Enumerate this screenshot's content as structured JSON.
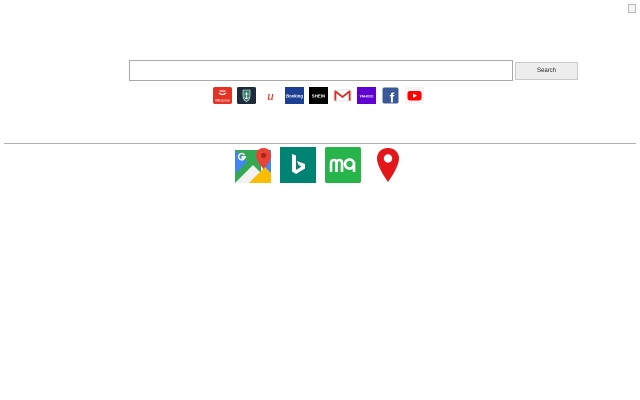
{
  "search": {
    "value": "",
    "placeholder": "",
    "button_label": "Search"
  },
  "shortcuts": [
    {
      "name": "aliexpress",
      "label": "AliExpress",
      "icon": "aliexpress-icon",
      "color": "#e43225"
    },
    {
      "name": "anchor",
      "label": "",
      "icon": "anchor-shield-icon",
      "color": "#1d2b3a"
    },
    {
      "name": "unknown-u",
      "label": "u",
      "icon": "u-logo-icon",
      "color": "#e2231a"
    },
    {
      "name": "booking",
      "label": "Booking",
      "icon": "booking-icon",
      "color": "#1c3f94"
    },
    {
      "name": "shein",
      "label": "SHEIN",
      "icon": "shein-icon",
      "color": "#000000"
    },
    {
      "name": "gmail",
      "label": "",
      "icon": "gmail-icon",
      "color": "#d93025"
    },
    {
      "name": "yahoo",
      "label": "YAHOO!",
      "icon": "yahoo-icon",
      "color": "#5f01d1"
    },
    {
      "name": "facebook",
      "label": "f",
      "icon": "facebook-icon",
      "color": "#3b5998"
    },
    {
      "name": "youtube",
      "label": "",
      "icon": "youtube-icon",
      "color": "#ff0000"
    }
  ],
  "apps": [
    {
      "name": "google-maps",
      "icon": "google-maps-icon"
    },
    {
      "name": "bing",
      "icon": "bing-icon",
      "color": "#008373"
    },
    {
      "name": "maps-me",
      "icon": "maps-me-icon",
      "color": "#27b44a"
    },
    {
      "name": "location-pin",
      "icon": "map-pin-icon",
      "color": "#e3161b"
    }
  ]
}
